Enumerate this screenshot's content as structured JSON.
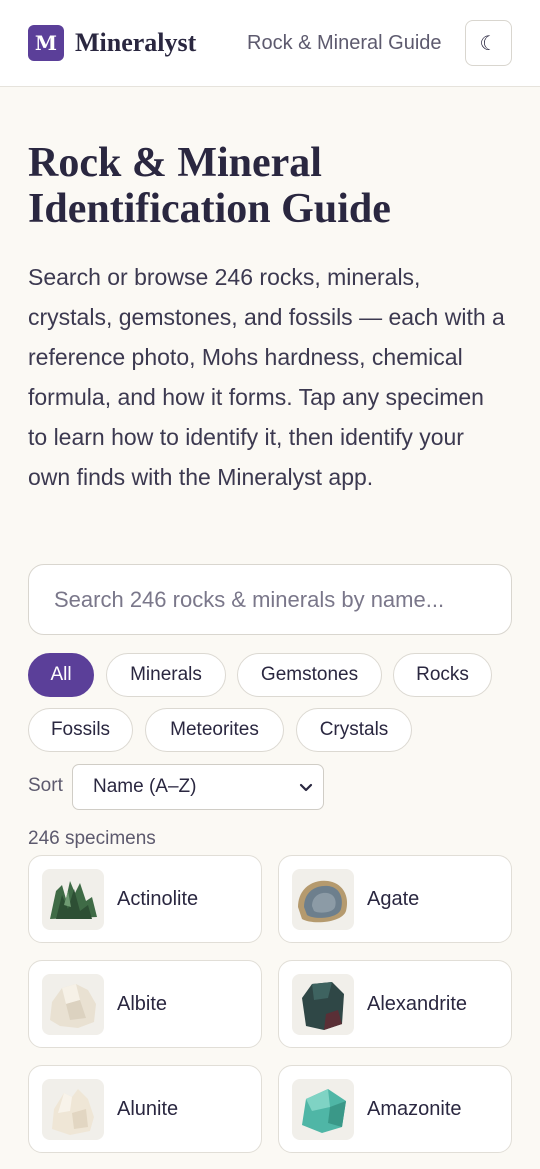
{
  "header": {
    "logo_letter": "M",
    "brand": "Mineralyst",
    "nav_link": "Rock & Mineral Guide",
    "theme_toggle_glyph": "☾"
  },
  "hero": {
    "title": "Rock & Mineral Identification Guide",
    "intro": "Search or browse 246 rocks, minerals, crystals, gemstones, and fossils — each with a reference photo, Mohs hardness, chemical formula, and how it forms. Tap any specimen to learn how to identify it, then identify your own finds with the Mineralyst app."
  },
  "search": {
    "placeholder": "Search 246 rocks & minerals by name..."
  },
  "filters": {
    "chips": [
      "All",
      "Minerals",
      "Gemstones",
      "Rocks",
      "Fossils",
      "Meteorites",
      "Crystals"
    ],
    "active": "All"
  },
  "sort": {
    "label": "Sort",
    "selected": "Name (A–Z)",
    "caret_icon": "chevron-down-icon"
  },
  "results": {
    "count_text": "246 specimens",
    "specimens": [
      {
        "name": "Actinolite",
        "color": "#3f6b46"
      },
      {
        "name": "Agate",
        "color": "#6d7f8d"
      },
      {
        "name": "Albite",
        "color": "#e9e1d2"
      },
      {
        "name": "Alexandrite",
        "color": "#2f4746"
      },
      {
        "name": "Alunite",
        "color": "#efe6d6"
      },
      {
        "name": "Amazonite",
        "color": "#4fb6a6"
      }
    ]
  },
  "colors": {
    "accent": "#5b3f99",
    "background": "#fbf9f4",
    "text": "#2a2740"
  }
}
